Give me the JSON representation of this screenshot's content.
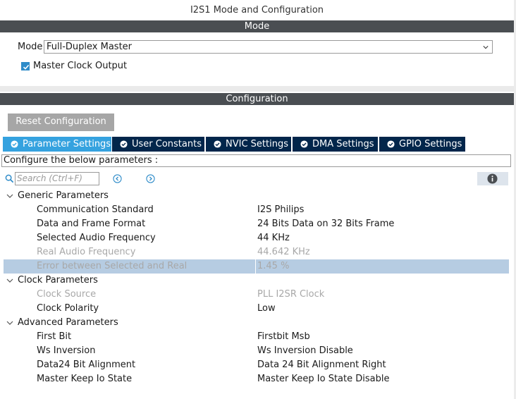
{
  "window": {
    "title": "I2S1 Mode and Configuration"
  },
  "mode_section": {
    "header": "Mode",
    "mode_label": "Mode",
    "mode_value": "Full-Duplex Master",
    "master_clock_output": {
      "label": "Master Clock Output",
      "checked": true
    }
  },
  "config_section": {
    "header": "Configuration",
    "reset_label": "Reset Configuration",
    "tabs": [
      {
        "label": "Parameter Settings",
        "active": true
      },
      {
        "label": "User Constants",
        "active": false
      },
      {
        "label": "NVIC Settings",
        "active": false
      },
      {
        "label": "DMA Settings",
        "active": false
      },
      {
        "label": "GPIO Settings",
        "active": false
      }
    ],
    "hint": "Configure the below parameters :",
    "search_placeholder": "Search (Ctrl+F)",
    "groups": [
      {
        "label": "Generic Parameters",
        "params": [
          {
            "name": "Communication Standard",
            "value": "I2S Philips"
          },
          {
            "name": "Data and Frame Format",
            "value": "24 Bits Data on 32 Bits Frame"
          },
          {
            "name": "Selected Audio Frequency",
            "value": "44 KHz"
          },
          {
            "name": "Real Audio Frequency",
            "value": "44.642 KHz"
          },
          {
            "name": "Error between Selected and Real",
            "value": "1.45 %"
          }
        ]
      },
      {
        "label": "Clock Parameters",
        "params": [
          {
            "name": "Clock Source",
            "value": "PLL I2SR Clock"
          },
          {
            "name": "Clock Polarity",
            "value": "Low"
          }
        ]
      },
      {
        "label": "Advanced Parameters",
        "params": [
          {
            "name": "First Bit",
            "value": "Firstbit Msb"
          },
          {
            "name": "Ws Inversion",
            "value": "Ws Inversion Disable"
          },
          {
            "name": "Data24 Bit Alignment",
            "value": "Data 24 Bit Alignment Right"
          },
          {
            "name": "Master Keep Io State",
            "value": "Master Keep Io State Disable"
          }
        ]
      }
    ]
  },
  "colors": {
    "section_bar": "#4a4e52",
    "tab_active": "#35a2df",
    "tab_inactive": "#02264b",
    "selected_row": "#b6cce2",
    "disabled_text": "#a8a8a8"
  },
  "icons": [
    "chevron-down-icon",
    "checkbox-checked-icon",
    "check-circle-icon",
    "search-icon",
    "chevron-left-circle-icon",
    "chevron-right-circle-icon",
    "info-icon",
    "expand-arrow-icon"
  ]
}
